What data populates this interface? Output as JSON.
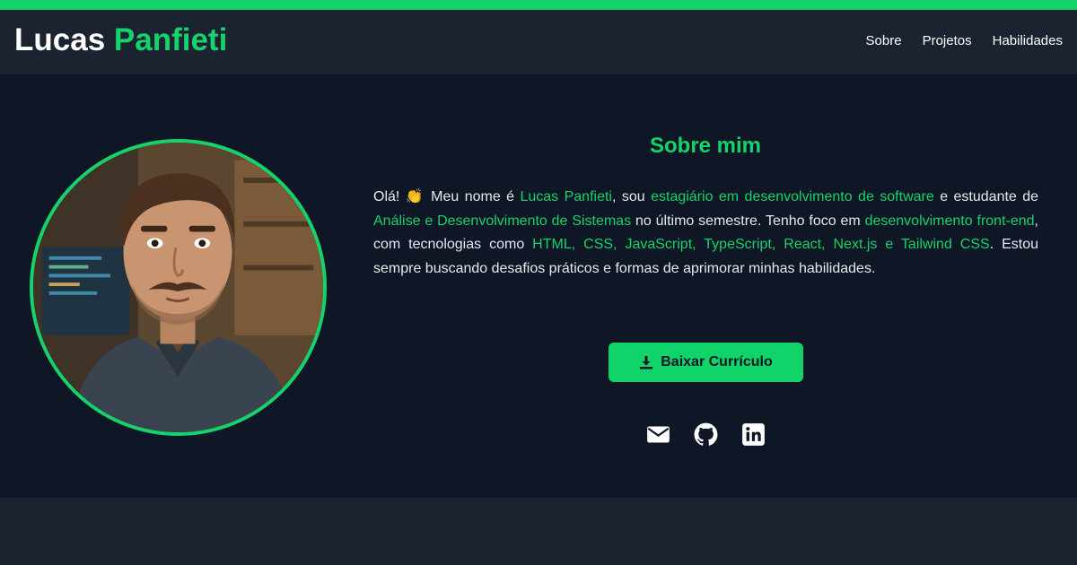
{
  "header": {
    "logo_first": "Lucas",
    "logo_second": "Panfieti",
    "nav": [
      {
        "label": "Sobre"
      },
      {
        "label": "Projetos"
      },
      {
        "label": "Habilidades"
      }
    ]
  },
  "about": {
    "title": "Sobre mim",
    "bio": {
      "p1": "Olá! ",
      "wave": "👏",
      "p2": "  Meu nome é ",
      "name": "Lucas Panfieti",
      "p3": ", sou ",
      "role": "estagiário em desenvolvimento de software",
      "p4": " e estudante de ",
      "course": "Análise e Desenvolvimento de Sistemas",
      "p5": " no último semestre. Tenho foco em ",
      "focus": "desenvolvimento front-end",
      "p6": ", com tecnologias como ",
      "t1": "HTML",
      "s1": ", ",
      "t2": "CSS",
      "s2": ", ",
      "t3": "JavaScript",
      "s3": ", ",
      "t4": "TypeScript",
      "s4": ", ",
      "t5": "React",
      "s5": ", ",
      "t6": "Next.js",
      "s6": " e ",
      "t7": "Tailwind CSS",
      "p7": ". Estou sempre buscando desafios práticos e formas de aprimorar minhas habilidades."
    },
    "cta_label": "Baixar Currículo",
    "socials": [
      {
        "icon": "envelope-icon"
      },
      {
        "icon": "github-icon"
      },
      {
        "icon": "linkedin-icon"
      }
    ]
  },
  "colors": {
    "accent": "#15d36b",
    "background": "#0f1626",
    "header": "#1b2331",
    "text": "#e6e8ec"
  }
}
